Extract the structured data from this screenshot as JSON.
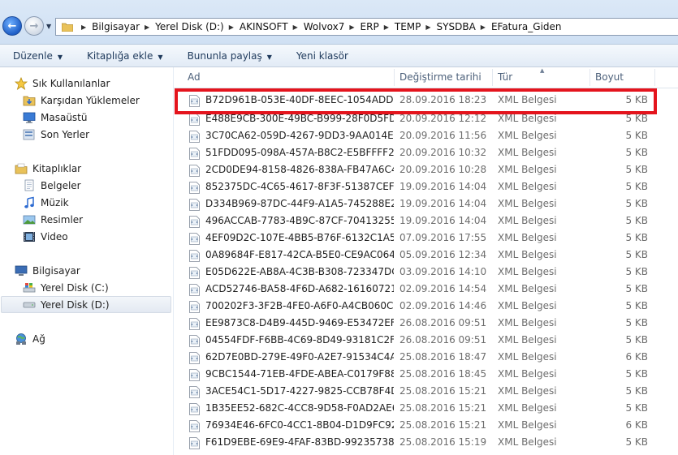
{
  "breadcrumbs": [
    "Bilgisayar",
    "Yerel Disk (D:)",
    "AKINSOFT",
    "Wolvox7",
    "ERP",
    "TEMP",
    "SYSDBA",
    "EFatura_Giden"
  ],
  "toolbar": {
    "organize": "Düzenle",
    "include_library": "Kitaplığa ekle",
    "share": "Bununla paylaş",
    "new_folder": "Yeni klasör"
  },
  "nav": {
    "favorites": {
      "label": "Sık Kullanılanlar",
      "items": [
        "Karşıdan Yüklemeler",
        "Masaüstü",
        "Son Yerler"
      ]
    },
    "libraries": {
      "label": "Kitaplıklar",
      "items": [
        "Belgeler",
        "Müzik",
        "Resimler",
        "Video"
      ]
    },
    "computer": {
      "label": "Bilgisayar",
      "items": [
        "Yerel Disk (C:)",
        "Yerel Disk (D:)"
      ]
    },
    "network": {
      "label": "Ağ"
    }
  },
  "columns": {
    "name": "Ad",
    "date": "Değiştirme tarihi",
    "type": "Tür",
    "size": "Boyut"
  },
  "files": [
    {
      "name": "B72D961B-053E-40DF-8EEC-1054ADD3789C",
      "date": "28.09.2016 18:23",
      "type": "XML Belgesi",
      "size": "5 KB"
    },
    {
      "name": "E488E9CB-300E-49BC-B999-28F0D5FDC6",
      "date": "20.09.2016 12:12",
      "type": "XML Belgesi",
      "size": "5 KB"
    },
    {
      "name": "3C70CA62-059D-4267-9DD3-9AA014E528",
      "date": "20.09.2016 11:56",
      "type": "XML Belgesi",
      "size": "5 KB"
    },
    {
      "name": "51FDD095-098A-457A-B8C2-E5BFFFF281E3",
      "date": "20.09.2016 10:32",
      "type": "XML Belgesi",
      "size": "5 KB"
    },
    {
      "name": "2CD0DE94-8158-4826-838A-FB47A6C445",
      "date": "20.09.2016 10:28",
      "type": "XML Belgesi",
      "size": "5 KB"
    },
    {
      "name": "852375DC-4C65-4617-8F3F-51387CEF1491",
      "date": "19.09.2016 14:04",
      "type": "XML Belgesi",
      "size": "5 KB"
    },
    {
      "name": "D334B969-87DC-44F9-A1A5-745288E26C19",
      "date": "19.09.2016 14:04",
      "type": "XML Belgesi",
      "size": "5 KB"
    },
    {
      "name": "496ACCAB-7783-4B9C-87CF-704132550578",
      "date": "19.09.2016 14:04",
      "type": "XML Belgesi",
      "size": "5 KB"
    },
    {
      "name": "4EF09D2C-107E-4BB5-B76F-6132C1A567C4",
      "date": "07.09.2016 17:55",
      "type": "XML Belgesi",
      "size": "5 KB"
    },
    {
      "name": "0A89684F-E817-42CA-B5E0-CE9AC064F987",
      "date": "05.09.2016 12:34",
      "type": "XML Belgesi",
      "size": "5 KB"
    },
    {
      "name": "E05D622E-AB8A-4C3B-B308-723347DCB4",
      "date": "03.09.2016 14:10",
      "type": "XML Belgesi",
      "size": "5 KB"
    },
    {
      "name": "ACD52746-BA58-4F6D-A682-16160721EF8B",
      "date": "02.09.2016 14:54",
      "type": "XML Belgesi",
      "size": "5 KB"
    },
    {
      "name": "700202F3-3F2B-4FE0-A6F0-A4CB060C2140",
      "date": "02.09.2016 14:46",
      "type": "XML Belgesi",
      "size": "5 KB"
    },
    {
      "name": "EE9873C8-D4B9-445D-9469-E53472EF69DB",
      "date": "26.08.2016 09:51",
      "type": "XML Belgesi",
      "size": "5 KB"
    },
    {
      "name": "04554FDF-F6BB-4C69-8D49-93181C2F52A0",
      "date": "26.08.2016 09:51",
      "type": "XML Belgesi",
      "size": "5 KB"
    },
    {
      "name": "62D7E0BD-279E-49F0-A2E7-91534C4AD1",
      "date": "25.08.2016 18:47",
      "type": "XML Belgesi",
      "size": "6 KB"
    },
    {
      "name": "9CBC1544-71EB-4FDE-ABEA-C0179F88F3",
      "date": "25.08.2016 18:45",
      "type": "XML Belgesi",
      "size": "5 KB"
    },
    {
      "name": "3ACE54C1-5D17-4227-9825-CCB78F4DE0",
      "date": "25.08.2016 15:21",
      "type": "XML Belgesi",
      "size": "5 KB"
    },
    {
      "name": "1B35EE52-682C-4CC8-9D58-F0AD2AE6C",
      "date": "25.08.2016 15:21",
      "type": "XML Belgesi",
      "size": "5 KB"
    },
    {
      "name": "76934E46-6FC0-4CC1-8B04-D1D9FC92F645",
      "date": "25.08.2016 15:21",
      "type": "XML Belgesi",
      "size": "6 KB"
    },
    {
      "name": "F61D9EBE-69E9-4FAF-83BD-992357384145",
      "date": "25.08.2016 15:19",
      "type": "XML Belgesi",
      "size": "5 KB"
    }
  ],
  "icons": {
    "back": "back-arrow-icon",
    "forward": "forward-arrow-icon",
    "file": "xml-document-icon",
    "favorites": "star-icon",
    "downloads": "downloads-folder-icon",
    "desktop": "desktop-icon",
    "recent": "recent-places-icon",
    "libraries": "library-icon",
    "documents": "documents-icon",
    "music": "music-icon",
    "pictures": "pictures-icon",
    "video": "video-icon",
    "computer": "computer-icon",
    "drive_c": "windows-drive-icon",
    "drive_d": "drive-icon",
    "network": "network-icon"
  },
  "colors": {
    "highlight_border": "#e4141d",
    "command_text": "#1e395b",
    "secondary_text": "#6d6d6d"
  }
}
